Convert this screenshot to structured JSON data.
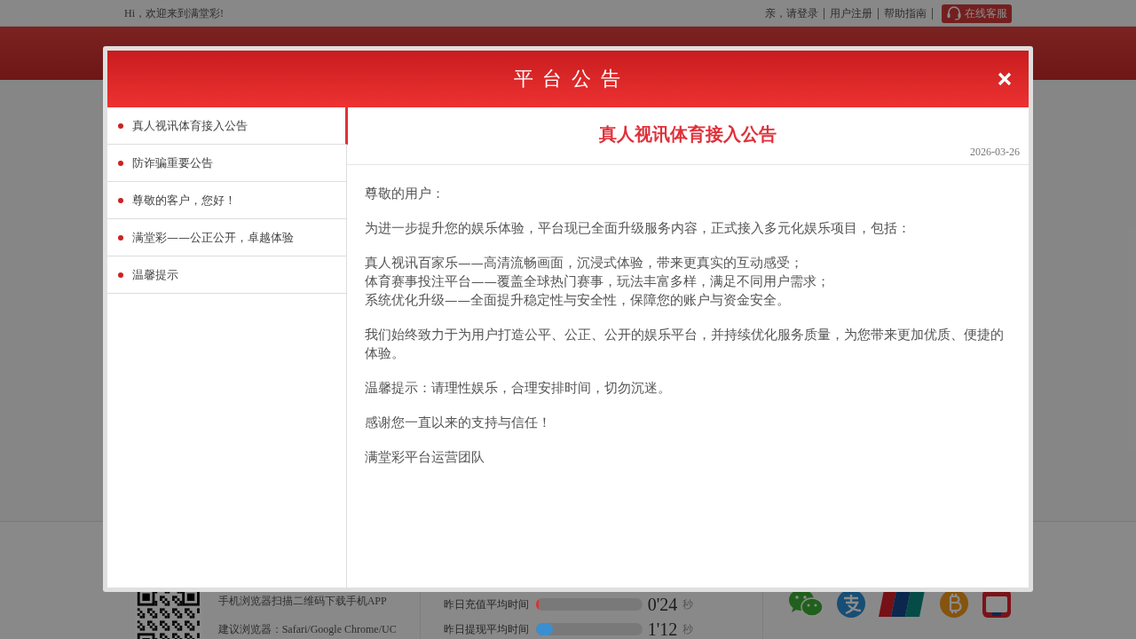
{
  "top_bar": {
    "greeting": "Hi，欢迎来到满堂彩!",
    "links": [
      "亲，请登录",
      "用户注册",
      "帮助指南"
    ],
    "service_button": "在线客服"
  },
  "notice_dialog": {
    "title": "平 台 公 告",
    "notices": [
      {
        "title": "真人视讯体育接入公告",
        "selected": true
      },
      {
        "title": "防诈骗重要公告",
        "selected": false
      },
      {
        "title": "尊敬的客户，您好！",
        "selected": false
      },
      {
        "title": "满堂彩——公正公开，卓越体验",
        "selected": false
      },
      {
        "title": "温馨提示",
        "selected": false
      }
    ],
    "article": {
      "title": "真人视讯体育接入公告",
      "date": "2026-03-26",
      "paragraphs": [
        [
          "尊敬的用户："
        ],
        [
          "为进一步提升您的娱乐体验，平台现已全面升级服务内容，正式接入多元化娱乐项目，包括："
        ],
        [
          "真人视讯百家乐——高清流畅画面，沉浸式体验，带来更真实的互动感受；",
          "体育赛事投注平台——覆盖全球热门赛事，玩法丰富多样，满足不同用户需求；",
          "系统优化升级——全面提升稳定性与安全性，保障您的账户与资金安全。"
        ],
        [
          "我们始终致力于为用户打造公平、公正、公开的娱乐平台，并持续优化服务质量，为您带来更加优质、便捷的体验。"
        ],
        [
          "温馨提示：请理性娱乐，合理安排时间，切勿沉迷。"
        ],
        [
          "感谢您一直以来的支持与信任！"
        ],
        [
          "满堂彩平台运营团队"
        ]
      ]
    }
  },
  "footer": {
    "app_download": "手机浏览器扫描二维码下载手机APP",
    "browser_hint": "建议浏览器：Safari/Google Chrome/UC",
    "stats": [
      {
        "label": "昨日充值平均时间",
        "level": 0.03,
        "color": "#e03030",
        "value": "0'24",
        "unit": "秒"
      },
      {
        "label": "昨日提现平均时间",
        "level": 0.16,
        "color": "#3a8fd0",
        "value": "1'12",
        "unit": "秒"
      }
    ]
  }
}
